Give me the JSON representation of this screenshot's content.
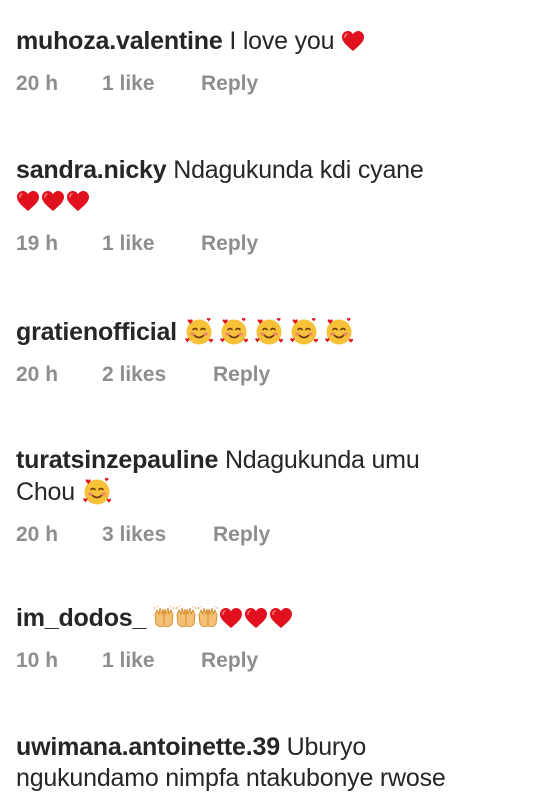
{
  "comments": [
    {
      "username": "muhoza.valentine",
      "text": "I love you",
      "emoji": [
        "red-heart"
      ],
      "time": "20 h",
      "likes": "1 like",
      "reply": "Reply"
    },
    {
      "username": "sandra.nicky",
      "text": "Ndagukunda kdi cyane",
      "emoji": [
        "red-heart",
        "red-heart",
        "red-heart"
      ],
      "time": "19 h",
      "likes": "1 like",
      "reply": "Reply"
    },
    {
      "username": "gratienofficial",
      "text": "",
      "emoji": [
        "smiling-face-with-hearts",
        "smiling-face-with-hearts",
        "smiling-face-with-hearts",
        "smiling-face-with-hearts",
        "smiling-face-with-hearts"
      ],
      "time": "20 h",
      "likes": "2 likes",
      "reply": "Reply"
    },
    {
      "username": "turatsinzepauline",
      "text_line1": "Ndagukunda umu",
      "text_line2": "Chou",
      "emoji": [
        "smiling-face-with-hearts"
      ],
      "time": "20 h",
      "likes": "3 likes",
      "reply": "Reply"
    },
    {
      "username": "im_dodos_",
      "text": "",
      "emoji": [
        "raising-hands",
        "raising-hands",
        "raising-hands",
        "red-heart",
        "red-heart",
        "red-heart"
      ],
      "time": "10 h",
      "likes": "1 like",
      "reply": "Reply"
    },
    {
      "username": "uwimana.antoinette.39",
      "text_line1": "Uburyo",
      "text_line2": "ngukundamo nimpfa ntakubonye rwose"
    }
  ],
  "colors": {
    "text": "#262626",
    "meta": "#8e8e8e",
    "heart": "#e0101e",
    "emoji_face": "#f7c23a"
  }
}
